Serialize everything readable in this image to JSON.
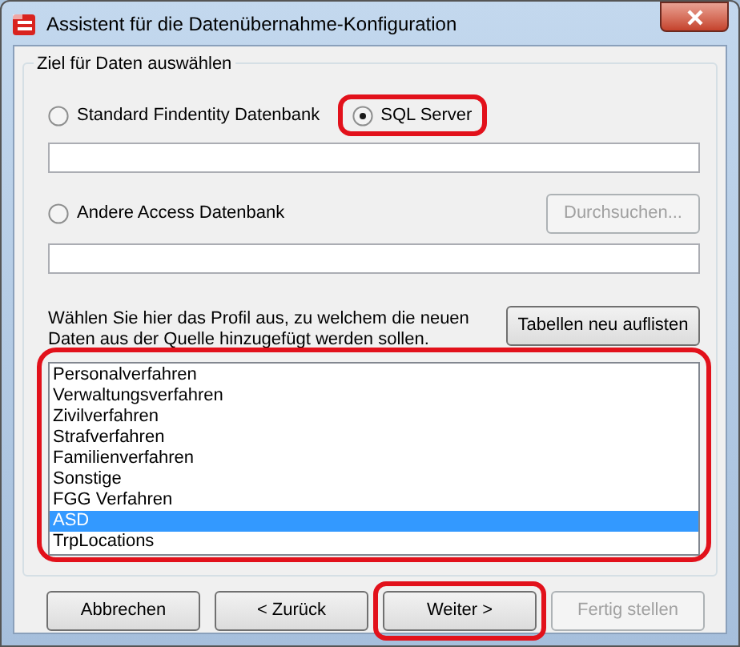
{
  "window": {
    "title": "Assistent für die Datenübernahme-Konfiguration"
  },
  "group": {
    "title": "Ziel für Daten auswählen"
  },
  "targets": [
    {
      "label": "Standard Findentity Datenbank",
      "selected": false,
      "highlighted": false
    },
    {
      "label": "SQL Server",
      "selected": true,
      "highlighted": true
    }
  ],
  "other_target": {
    "label": "Andere Access Datenbank",
    "selected": false
  },
  "browse_button": {
    "label": "Durchsuchen...",
    "disabled": true
  },
  "instruction": "Wählen Sie hier das Profil aus, zu welchem die neuen Daten aus der Quelle hinzugefügt werden sollen.",
  "refresh_button": {
    "label": "Tabellen neu auflisten"
  },
  "profile_list": {
    "highlighted": true,
    "items": [
      {
        "label": "Personalverfahren",
        "selected": false
      },
      {
        "label": "Verwaltungsverfahren",
        "selected": false
      },
      {
        "label": "Zivilverfahren",
        "selected": false
      },
      {
        "label": "Strafverfahren",
        "selected": false
      },
      {
        "label": "Familienverfahren",
        "selected": false
      },
      {
        "label": "Sonstige",
        "selected": false
      },
      {
        "label": "FGG Verfahren",
        "selected": false
      },
      {
        "label": "ASD",
        "selected": true
      },
      {
        "label": "TrpLocations",
        "selected": false
      }
    ]
  },
  "buttons": [
    {
      "label": "Abbrechen",
      "disabled": false,
      "highlighted": false
    },
    {
      "label": "< Zurück",
      "disabled": false,
      "highlighted": false
    },
    {
      "label": "Weiter >",
      "disabled": false,
      "highlighted": true
    },
    {
      "label": "Fertig stellen",
      "disabled": true,
      "highlighted": false
    }
  ]
}
